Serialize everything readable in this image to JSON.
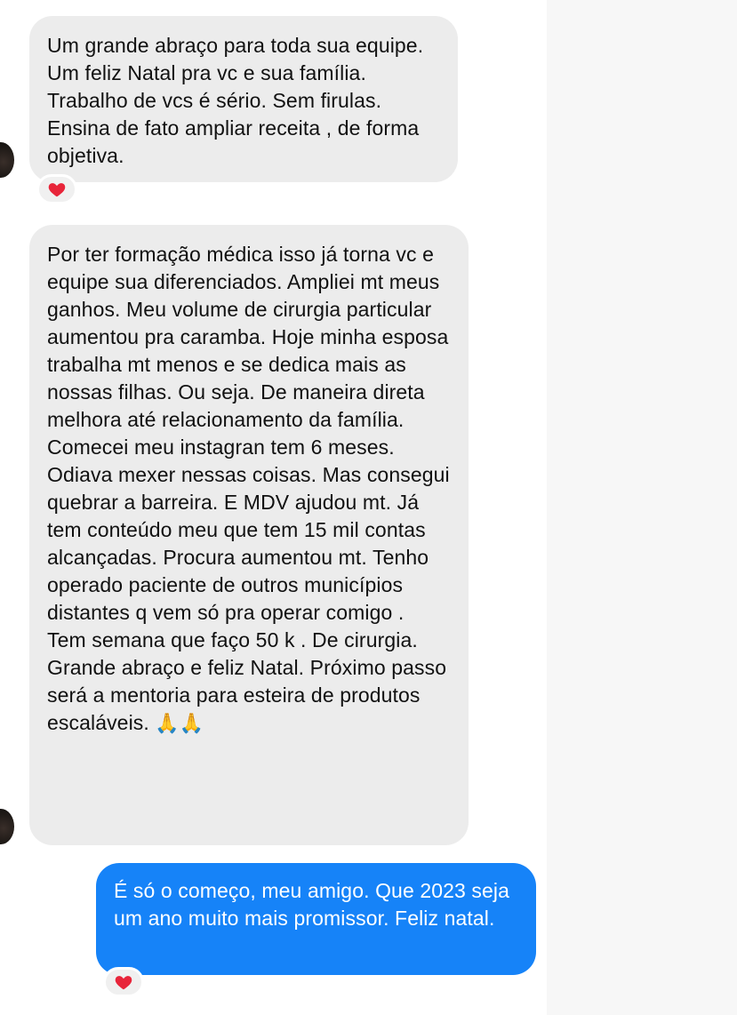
{
  "conversation": {
    "messages": [
      {
        "direction": "incoming",
        "text": "Um grande abraço para toda sua equipe. Um feliz Natal pra vc e sua família. Trabalho de vcs é sério. Sem firulas.  Ensina de fato ampliar receita , de forma objetiva.",
        "reaction": "heart"
      },
      {
        "direction": "incoming",
        "paragraphs": [
          "Por ter formação médica isso já torna vc e equipe sua diferenciados.  Ampliei mt meus ganhos. Meu volume de cirurgia particular aumentou pra caramba. Hoje minha esposa trabalha mt menos e se dedica mais as nossas filhas. Ou seja. De maneira direta melhora até relacionamento da família.",
          "Comecei meu instagran tem 6 meses. Odiava mexer nessas coisas. Mas consegui quebrar a barreira. E MDV ajudou mt. Já tem conteúdo meu que tem 15 mil contas alcançadas.   Procura aumentou mt. Tenho operado paciente de outros municípios distantes q vem só pra operar comigo .",
          "Tem semana que faço 50 k . De cirurgia.",
          "Grande abraço e feliz Natal. Próximo passo será a mentoria para esteira de produtos escaláveis."
        ],
        "trailing_emoji": "🙏🙏"
      },
      {
        "direction": "outgoing",
        "text": "É só o começo, meu amigo. Que 2023 seja um ano muito mais promissor. Feliz natal.",
        "reaction": "heart"
      }
    ]
  },
  "colors": {
    "incoming_bubble": "#ececec",
    "outgoing_bubble": "#1683f8",
    "reaction_heart": "#e8253a"
  }
}
